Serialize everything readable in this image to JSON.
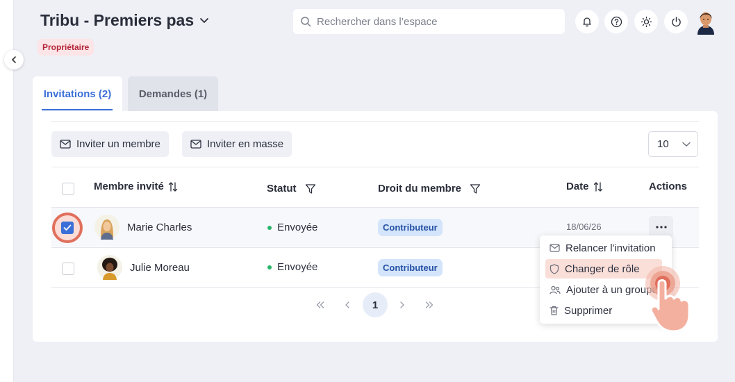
{
  "header": {
    "space_title": "Tribu - Premiers pas",
    "owner_badge": "Propriétaire",
    "search_placeholder": "Rechercher dans l’espace"
  },
  "tabs": [
    {
      "label": "Invitations (2)",
      "active": true
    },
    {
      "label": "Demandes (1)",
      "active": false
    }
  ],
  "toolbar": {
    "invite_member_label": "Inviter un membre",
    "invite_bulk_label": "Inviter en masse",
    "page_size_value": "10"
  },
  "table": {
    "columns": [
      "Membre invité",
      "Statut",
      "Droit du membre",
      "Date",
      "Actions"
    ],
    "rows": [
      {
        "name": "Marie Charles",
        "status": "Envoyée",
        "role": "Contributeur",
        "date": "18/06/26",
        "checked": true
      },
      {
        "name": "Julie Moreau",
        "status": "Envoyée",
        "role": "Contributeur",
        "date": "",
        "checked": false
      }
    ]
  },
  "pagination": {
    "current_page": "1"
  },
  "actions_menu": {
    "items": [
      "Relancer l'invitation",
      "Changer de rôle",
      "Ajouter à un groupe",
      "Supprimer"
    ],
    "highlighted": "Changer de rôle"
  },
  "colors": {
    "accent": "#3b6fd8",
    "owner_badge_bg": "#fde4e6",
    "owner_badge_text": "#b3263a",
    "status_dot": "#27b56a",
    "role_badge_bg": "#d4e5fb",
    "highlight": "#fadfd9",
    "pointer": "#e06f5c"
  }
}
